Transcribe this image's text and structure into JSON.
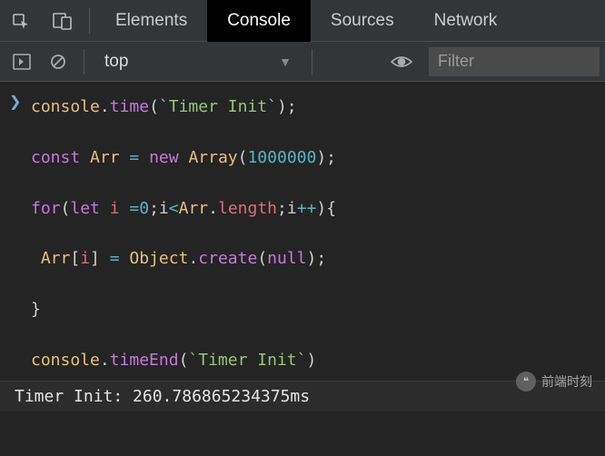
{
  "tabs": {
    "items": [
      {
        "label": "Elements"
      },
      {
        "label": "Console"
      },
      {
        "label": "Sources"
      },
      {
        "label": "Network"
      }
    ],
    "activeIndex": 1
  },
  "toolbar": {
    "context": "top",
    "filterPlaceholder": "Filter"
  },
  "code": {
    "line1_obj": "console",
    "line1_method": "time",
    "line1_str": "`Timer Init`",
    "line3_kw1": "const",
    "line3_var": "Arr",
    "line3_kw2": "new",
    "line3_cls": "Array",
    "line3_num": "1000000",
    "line5_kw1": "for",
    "line5_kw2": "let",
    "line5_var": "i",
    "line5_num": "0",
    "line5_arr": "Arr",
    "line5_prop": "length",
    "line7_arr": "Arr",
    "line7_idx": "i",
    "line7_cls": "Object",
    "line7_method": "create",
    "line7_kw": "null",
    "line11_obj": "console",
    "line11_method": "timeEnd",
    "line11_str": "`Timer Init`"
  },
  "output": {
    "text": "Timer Init: 260.786865234375ms"
  },
  "watermark": {
    "text": "前端时刻"
  }
}
